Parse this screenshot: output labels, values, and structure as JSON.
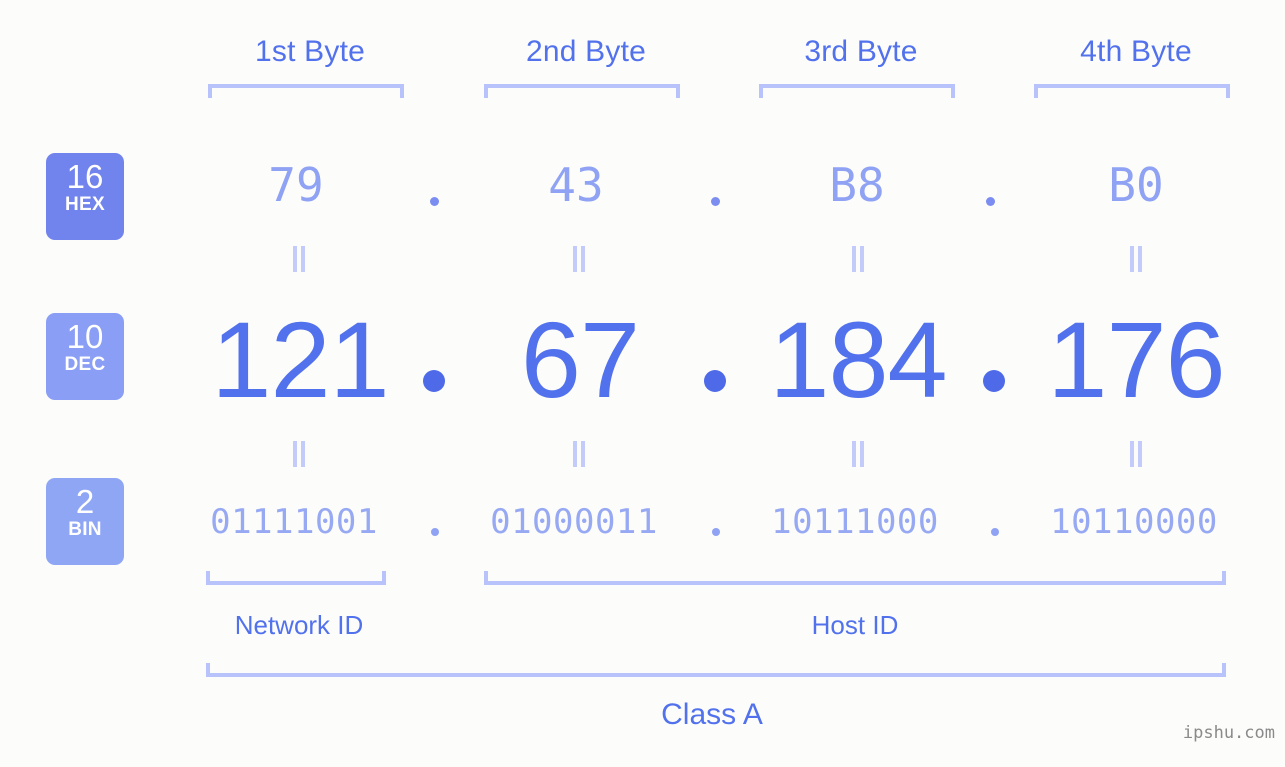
{
  "background_color": "#fcfdfa",
  "accent_color": "#5271ed",
  "bracket_color": "#b9c3fb",
  "byte_headers": [
    {
      "label": "1st Byte"
    },
    {
      "label": "2nd Byte"
    },
    {
      "label": "3rd Byte"
    },
    {
      "label": "4th Byte"
    }
  ],
  "bases": [
    {
      "num": "16",
      "label": "HEX",
      "color": "#7183ec"
    },
    {
      "num": "10",
      "label": "DEC",
      "color": "#899ef4"
    },
    {
      "num": "2",
      "label": "BIN",
      "color": "#8fa6f5"
    }
  ],
  "rows": {
    "hex": {
      "base_num": "16",
      "base_label": "HEX",
      "octets": [
        "79",
        "43",
        "B8",
        "B0"
      ],
      "separator": "."
    },
    "dec": {
      "base_num": "10",
      "base_label": "DEC",
      "octets": [
        "121",
        "67",
        "184",
        "176"
      ],
      "separator": "."
    },
    "bin": {
      "base_num": "2",
      "base_label": "BIN",
      "octets": [
        "01111001",
        "01000011",
        "10111000",
        "10110000"
      ],
      "separator": "."
    }
  },
  "equality_symbol": "=",
  "segments": {
    "network_id": "Network ID",
    "host_id": "Host ID",
    "class": "Class A"
  },
  "watermark": "ipshu.com"
}
